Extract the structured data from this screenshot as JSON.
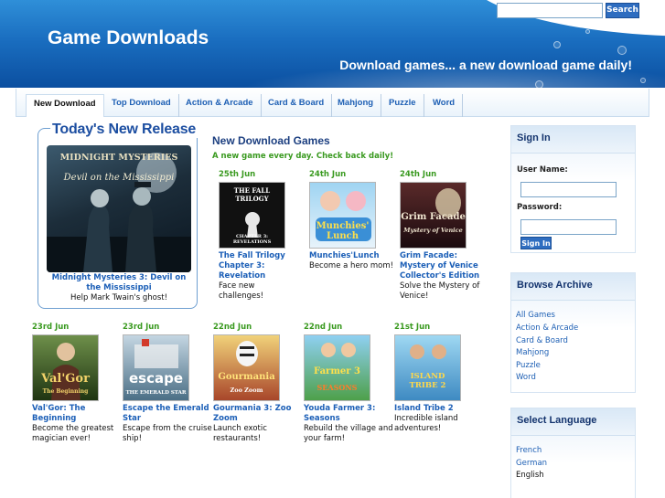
{
  "header": {
    "title": "Game Downloads",
    "tagline": "Download games... a new download game daily!",
    "search_button": "Search",
    "search_value": ""
  },
  "nav": {
    "items": [
      {
        "label": "New Download"
      },
      {
        "label": "Top Download"
      },
      {
        "label": "Action & Arcade"
      },
      {
        "label": "Card & Board"
      },
      {
        "label": "Mahjong"
      },
      {
        "label": "Puzzle"
      },
      {
        "label": "Word"
      }
    ]
  },
  "release": {
    "heading": "Today's New Release",
    "image_logo": "MIDNIGHT MYSTERIES",
    "image_subtitle": "Devil on the Mississippi",
    "title": "Midnight Mysteries 3: Devil on the Mississippi",
    "description": "Help Mark Twain's ghost!"
  },
  "main": {
    "title": "New Download Games",
    "subtitle": "A new game every day. Check back daily!",
    "games": [
      {
        "date": "25th Jun",
        "name": "The Fall Trilogy Chapter 3: Revelation",
        "desc": "Face new challenges!",
        "thumb_text": "THE FALL TRILOGY",
        "thumb_sub": "CHAPTER 3: REVELATIONS",
        "color": "#111111"
      },
      {
        "date": "24th Jun",
        "name": "Munchies'Lunch",
        "desc": "Become a hero mom!",
        "thumb_text": "Munchies' Lunch",
        "thumb_sub": "",
        "color": "#2a8fd6"
      },
      {
        "date": "24th Jun",
        "name": "Grim Facade: Mystery of Venice Collector's Edition",
        "desc": "Solve the Mystery of Venice!",
        "thumb_text": "Grim Facade",
        "thumb_sub": "Mystery of Venice",
        "color": "#3a1418"
      },
      {
        "date": "23rd Jun",
        "name": "Val'Gor: The Beginning",
        "desc": "Become the greatest magician ever!",
        "thumb_text": "Val'Gor",
        "thumb_sub": "The Beginning",
        "color": "#2d4a1c"
      },
      {
        "date": "23rd Jun",
        "name": "Escape the Emerald Star",
        "desc": "Escape from the cruise ship!",
        "thumb_text": "escape",
        "thumb_sub": "THE EMERALD STAR",
        "color": "#4b6f86"
      },
      {
        "date": "22nd Jun",
        "name": "Gourmania 3: Zoo Zoom",
        "desc": "Launch exotic restaurants!",
        "thumb_text": "Gourmania",
        "thumb_sub": "Zoo Zoom",
        "color": "#a8462a"
      },
      {
        "date": "22nd Jun",
        "name": "Youda Farmer 3: Seasons",
        "desc": "Rebuild the village and your farm!",
        "thumb_text": "Farmer 3",
        "thumb_sub": "SEASONS",
        "color": "#4e9fd6"
      },
      {
        "date": "21st Jun",
        "name": "Island Tribe 2",
        "desc": "Incredible island adventures!",
        "thumb_text": "ISLAND TRIBE 2",
        "thumb_sub": "",
        "color": "#6ab0d8"
      }
    ]
  },
  "signin": {
    "heading": "Sign In",
    "username_label": "User Name:",
    "password_label": "Password:",
    "button": "Sign In"
  },
  "archive": {
    "heading": "Browse Archive",
    "links": [
      "All Games",
      "Action & Arcade",
      "Card & Board",
      "Mahjong",
      "Puzzle",
      "Word"
    ]
  },
  "language": {
    "heading": "Select Language",
    "options": [
      "French",
      "German",
      "English"
    ]
  }
}
